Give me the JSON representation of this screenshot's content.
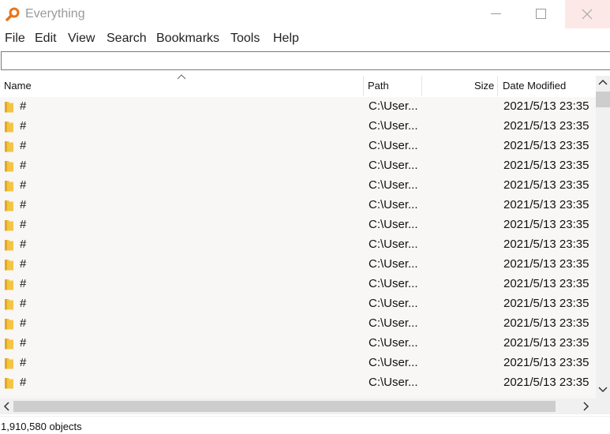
{
  "window": {
    "title": "Everything"
  },
  "menu": [
    "File",
    "Edit",
    "View",
    "Search",
    "Bookmarks",
    "Tools",
    "Help"
  ],
  "search": {
    "value": "",
    "placeholder": ""
  },
  "columns": {
    "name": "Name",
    "path": "Path",
    "size": "Size",
    "date": "Date Modified"
  },
  "rows": [
    {
      "name": "#",
      "path": "C:\\User...",
      "size": "",
      "date": "2021/5/13 23:35"
    },
    {
      "name": "#",
      "path": "C:\\User...",
      "size": "",
      "date": "2021/5/13 23:35"
    },
    {
      "name": "#",
      "path": "C:\\User...",
      "size": "",
      "date": "2021/5/13 23:35"
    },
    {
      "name": "#",
      "path": "C:\\User...",
      "size": "",
      "date": "2021/5/13 23:35"
    },
    {
      "name": "#",
      "path": "C:\\User...",
      "size": "",
      "date": "2021/5/13 23:35"
    },
    {
      "name": "#",
      "path": "C:\\User...",
      "size": "",
      "date": "2021/5/13 23:35"
    },
    {
      "name": "#",
      "path": "C:\\User...",
      "size": "",
      "date": "2021/5/13 23:35"
    },
    {
      "name": "#",
      "path": "C:\\User...",
      "size": "",
      "date": "2021/5/13 23:35"
    },
    {
      "name": "#",
      "path": "C:\\User...",
      "size": "",
      "date": "2021/5/13 23:35"
    },
    {
      "name": "#",
      "path": "C:\\User...",
      "size": "",
      "date": "2021/5/13 23:35"
    },
    {
      "name": "#",
      "path": "C:\\User...",
      "size": "",
      "date": "2021/5/13 23:35"
    },
    {
      "name": "#",
      "path": "C:\\User...",
      "size": "",
      "date": "2021/5/13 23:35"
    },
    {
      "name": "#",
      "path": "C:\\User...",
      "size": "",
      "date": "2021/5/13 23:35"
    },
    {
      "name": "#",
      "path": "C:\\User...",
      "size": "",
      "date": "2021/5/13 23:35"
    },
    {
      "name": "#",
      "path": "C:\\User...",
      "size": "",
      "date": "2021/5/13 23:35"
    }
  ],
  "status": {
    "text": "1,910,580 objects"
  },
  "colors": {
    "folder": "#f5c542",
    "list_bg": "#f8f7f5",
    "close_hover": "#fde8e8",
    "app_icon": "#e8751a"
  },
  "icons": {
    "app": "magnifier-icon",
    "folder": "folder-icon"
  }
}
